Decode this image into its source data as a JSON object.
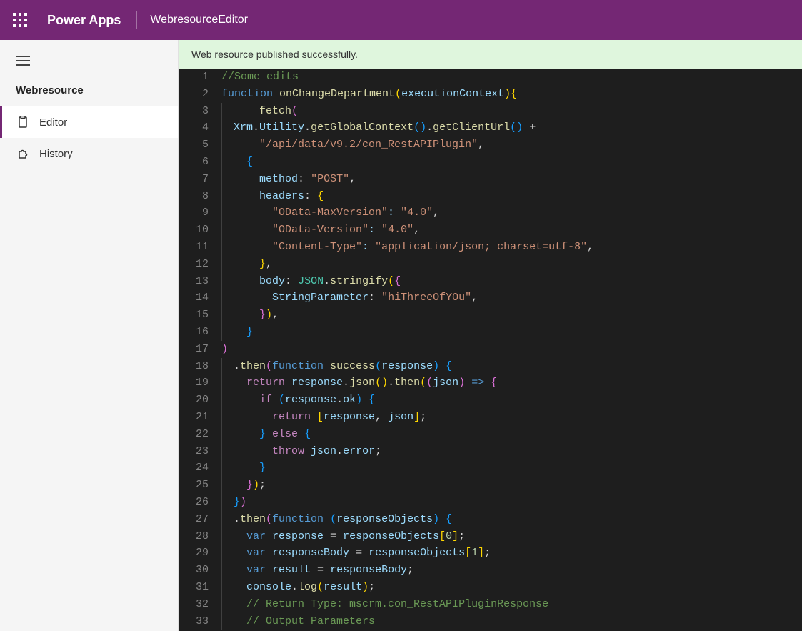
{
  "header": {
    "app_title": "Power Apps",
    "page_title": "WebresourceEditor"
  },
  "sidebar": {
    "section": "Webresource",
    "items": [
      {
        "label": "Editor",
        "icon": "clipboard-icon",
        "active": true
      },
      {
        "label": "History",
        "icon": "puzzle-icon",
        "active": false
      }
    ]
  },
  "banner": {
    "message": "Web resource published successfully."
  },
  "editor": {
    "line_count": 33,
    "code_tokens": [
      [
        [
          "c-cmt",
          "//Some edits"
        ]
      ],
      [
        [
          "c-kw",
          "function "
        ],
        [
          "c-fn",
          "onChangeDepartment"
        ],
        [
          "c-yel",
          "("
        ],
        [
          "c-prm",
          "executionContext"
        ],
        [
          "c-yel",
          ")"
        ],
        [
          "c-yel",
          "{"
        ]
      ],
      [
        [
          "",
          ""
        ],
        [
          "",
          "    "
        ],
        [
          "c-fn",
          "fetch"
        ],
        [
          "c-pur",
          "("
        ]
      ],
      [
        [
          "",
          ""
        ],
        [
          "c-prm",
          "Xrm"
        ],
        [
          "c-pun",
          "."
        ],
        [
          "c-prm",
          "Utility"
        ],
        [
          "c-pun",
          "."
        ],
        [
          "c-fn",
          "getGlobalContext"
        ],
        [
          "c-blu",
          "("
        ],
        [
          "c-blu",
          ")"
        ],
        [
          "c-pun",
          "."
        ],
        [
          "c-fn",
          "getClientUrl"
        ],
        [
          "c-blu",
          "("
        ],
        [
          "c-blu",
          ")"
        ],
        [
          "c-pun",
          " +"
        ]
      ],
      [
        [
          "",
          ""
        ],
        [
          "",
          "    "
        ],
        [
          "c-str",
          "\"/api/data/v9.2/con_RestAPIPlugin\""
        ],
        [
          "c-pun",
          ","
        ]
      ],
      [
        [
          "",
          ""
        ],
        [
          "",
          "  "
        ],
        [
          "c-blu",
          "{"
        ]
      ],
      [
        [
          "",
          ""
        ],
        [
          "",
          "    "
        ],
        [
          "c-prop",
          "method"
        ],
        [
          "c-pun",
          ":"
        ],
        [
          "c-pun",
          " "
        ],
        [
          "c-str",
          "\"POST\""
        ],
        [
          "c-pun",
          ","
        ]
      ],
      [
        [
          "",
          ""
        ],
        [
          "",
          "    "
        ],
        [
          "c-prop",
          "headers"
        ],
        [
          "c-pun",
          ":"
        ],
        [
          "c-pun",
          " "
        ],
        [
          "c-yel",
          "{"
        ]
      ],
      [
        [
          "",
          ""
        ],
        [
          "",
          "      "
        ],
        [
          "c-str",
          "\"OData-MaxVersion\""
        ],
        [
          "c-prop",
          ":"
        ],
        [
          "c-pun",
          " "
        ],
        [
          "c-str",
          "\"4.0\""
        ],
        [
          "c-pun",
          ","
        ]
      ],
      [
        [
          "",
          ""
        ],
        [
          "",
          "      "
        ],
        [
          "c-str",
          "\"OData-Version\""
        ],
        [
          "c-prop",
          ":"
        ],
        [
          "c-pun",
          " "
        ],
        [
          "c-str",
          "\"4.0\""
        ],
        [
          "c-pun",
          ","
        ]
      ],
      [
        [
          "",
          ""
        ],
        [
          "",
          "      "
        ],
        [
          "c-str",
          "\"Content-Type\""
        ],
        [
          "c-prop",
          ":"
        ],
        [
          "c-pun",
          " "
        ],
        [
          "c-str",
          "\"application/json; charset=utf-8\""
        ],
        [
          "c-pun",
          ","
        ]
      ],
      [
        [
          "",
          ""
        ],
        [
          "",
          "    "
        ],
        [
          "c-yel",
          "}"
        ],
        [
          "c-pun",
          ","
        ]
      ],
      [
        [
          "",
          ""
        ],
        [
          "",
          "    "
        ],
        [
          "c-prop",
          "body"
        ],
        [
          "c-pun",
          ":"
        ],
        [
          "c-pun",
          " "
        ],
        [
          "c-cls",
          "JSON"
        ],
        [
          "c-pun",
          "."
        ],
        [
          "c-fn",
          "stringify"
        ],
        [
          "c-yel",
          "("
        ],
        [
          "c-pur",
          "{"
        ]
      ],
      [
        [
          "",
          ""
        ],
        [
          "",
          "      "
        ],
        [
          "c-prop",
          "StringParameter"
        ],
        [
          "c-pun",
          ":"
        ],
        [
          "c-pun",
          " "
        ],
        [
          "c-str",
          "\"hiThreeOfYOu\""
        ],
        [
          "c-pun",
          ","
        ]
      ],
      [
        [
          "",
          ""
        ],
        [
          "",
          "    "
        ],
        [
          "c-pur",
          "}"
        ],
        [
          "c-yel",
          ")"
        ],
        [
          "c-pun",
          ","
        ]
      ],
      [
        [
          "",
          ""
        ],
        [
          "",
          "  "
        ],
        [
          "c-blu",
          "}"
        ]
      ],
      [
        [
          "c-pur",
          ")"
        ]
      ],
      [
        [
          "",
          ""
        ],
        [
          "c-pun",
          "."
        ],
        [
          "c-fn",
          "then"
        ],
        [
          "c-pur",
          "("
        ],
        [
          "c-kw",
          "function "
        ],
        [
          "c-fn",
          "success"
        ],
        [
          "c-blu",
          "("
        ],
        [
          "c-prm",
          "response"
        ],
        [
          "c-blu",
          ")"
        ],
        [
          "c-pun",
          " "
        ],
        [
          "c-blu",
          "{"
        ]
      ],
      [
        [
          "",
          ""
        ],
        [
          "",
          "  "
        ],
        [
          "c-ctl",
          "return "
        ],
        [
          "c-prm",
          "response"
        ],
        [
          "c-pun",
          "."
        ],
        [
          "c-fn",
          "json"
        ],
        [
          "c-yel",
          "("
        ],
        [
          "c-yel",
          ")"
        ],
        [
          "c-pun",
          "."
        ],
        [
          "c-fn",
          "then"
        ],
        [
          "c-yel",
          "("
        ],
        [
          "c-pur",
          "("
        ],
        [
          "c-prm",
          "json"
        ],
        [
          "c-pur",
          ")"
        ],
        [
          "c-kw",
          " => "
        ],
        [
          "c-pur",
          "{"
        ]
      ],
      [
        [
          "",
          ""
        ],
        [
          "",
          "    "
        ],
        [
          "c-ctl",
          "if "
        ],
        [
          "c-blu",
          "("
        ],
        [
          "c-prm",
          "response"
        ],
        [
          "c-pun",
          "."
        ],
        [
          "c-prop",
          "ok"
        ],
        [
          "c-blu",
          ")"
        ],
        [
          "c-pun",
          " "
        ],
        [
          "c-blu",
          "{"
        ]
      ],
      [
        [
          "",
          ""
        ],
        [
          "",
          "      "
        ],
        [
          "c-ctl",
          "return "
        ],
        [
          "c-yel",
          "["
        ],
        [
          "c-prm",
          "response"
        ],
        [
          "c-pun",
          ", "
        ],
        [
          "c-prm",
          "json"
        ],
        [
          "c-yel",
          "]"
        ],
        [
          "c-pun",
          ";"
        ]
      ],
      [
        [
          "",
          ""
        ],
        [
          "",
          "    "
        ],
        [
          "c-blu",
          "}"
        ],
        [
          "c-pun",
          " "
        ],
        [
          "c-ctl",
          "else"
        ],
        [
          "c-pun",
          " "
        ],
        [
          "c-blu",
          "{"
        ]
      ],
      [
        [
          "",
          ""
        ],
        [
          "",
          "      "
        ],
        [
          "c-ctl",
          "throw "
        ],
        [
          "c-prm",
          "json"
        ],
        [
          "c-pun",
          "."
        ],
        [
          "c-prop",
          "error"
        ],
        [
          "c-pun",
          ";"
        ]
      ],
      [
        [
          "",
          ""
        ],
        [
          "",
          "    "
        ],
        [
          "c-blu",
          "}"
        ]
      ],
      [
        [
          "",
          ""
        ],
        [
          "",
          "  "
        ],
        [
          "c-pur",
          "}"
        ],
        [
          "c-yel",
          ")"
        ],
        [
          "c-pun",
          ";"
        ]
      ],
      [
        [
          "",
          ""
        ],
        [
          "c-blu",
          "}"
        ],
        [
          "c-pur",
          ")"
        ]
      ],
      [
        [
          "",
          ""
        ],
        [
          "c-pun",
          "."
        ],
        [
          "c-fn",
          "then"
        ],
        [
          "c-pur",
          "("
        ],
        [
          "c-kw",
          "function "
        ],
        [
          "c-blu",
          "("
        ],
        [
          "c-prm",
          "responseObjects"
        ],
        [
          "c-blu",
          ")"
        ],
        [
          "c-pun",
          " "
        ],
        [
          "c-blu",
          "{"
        ]
      ],
      [
        [
          "",
          ""
        ],
        [
          "",
          "  "
        ],
        [
          "c-kw",
          "var "
        ],
        [
          "c-prm",
          "response"
        ],
        [
          "c-pun",
          " = "
        ],
        [
          "c-prm",
          "responseObjects"
        ],
        [
          "c-yel",
          "["
        ],
        [
          "c-num",
          "0"
        ],
        [
          "c-yel",
          "]"
        ],
        [
          "c-pun",
          ";"
        ]
      ],
      [
        [
          "",
          ""
        ],
        [
          "",
          "  "
        ],
        [
          "c-kw",
          "var "
        ],
        [
          "c-prm",
          "responseBody"
        ],
        [
          "c-pun",
          " = "
        ],
        [
          "c-prm",
          "responseObjects"
        ],
        [
          "c-yel",
          "["
        ],
        [
          "c-num",
          "1"
        ],
        [
          "c-yel",
          "]"
        ],
        [
          "c-pun",
          ";"
        ]
      ],
      [
        [
          "",
          ""
        ],
        [
          "",
          "  "
        ],
        [
          "c-kw",
          "var "
        ],
        [
          "c-prm",
          "result"
        ],
        [
          "c-pun",
          " = "
        ],
        [
          "c-prm",
          "responseBody"
        ],
        [
          "c-pun",
          ";"
        ]
      ],
      [
        [
          "",
          ""
        ],
        [
          "",
          "  "
        ],
        [
          "c-prm",
          "console"
        ],
        [
          "c-pun",
          "."
        ],
        [
          "c-fn",
          "log"
        ],
        [
          "c-yel",
          "("
        ],
        [
          "c-prm",
          "result"
        ],
        [
          "c-yel",
          ")"
        ],
        [
          "c-pun",
          ";"
        ]
      ],
      [
        [
          "",
          ""
        ],
        [
          "",
          "  "
        ],
        [
          "c-cmt",
          "// Return Type: mscrm.con_RestAPIPluginResponse"
        ]
      ],
      [
        [
          "",
          ""
        ],
        [
          "",
          "  "
        ],
        [
          "c-cmt",
          "// Output Parameters"
        ]
      ]
    ]
  }
}
